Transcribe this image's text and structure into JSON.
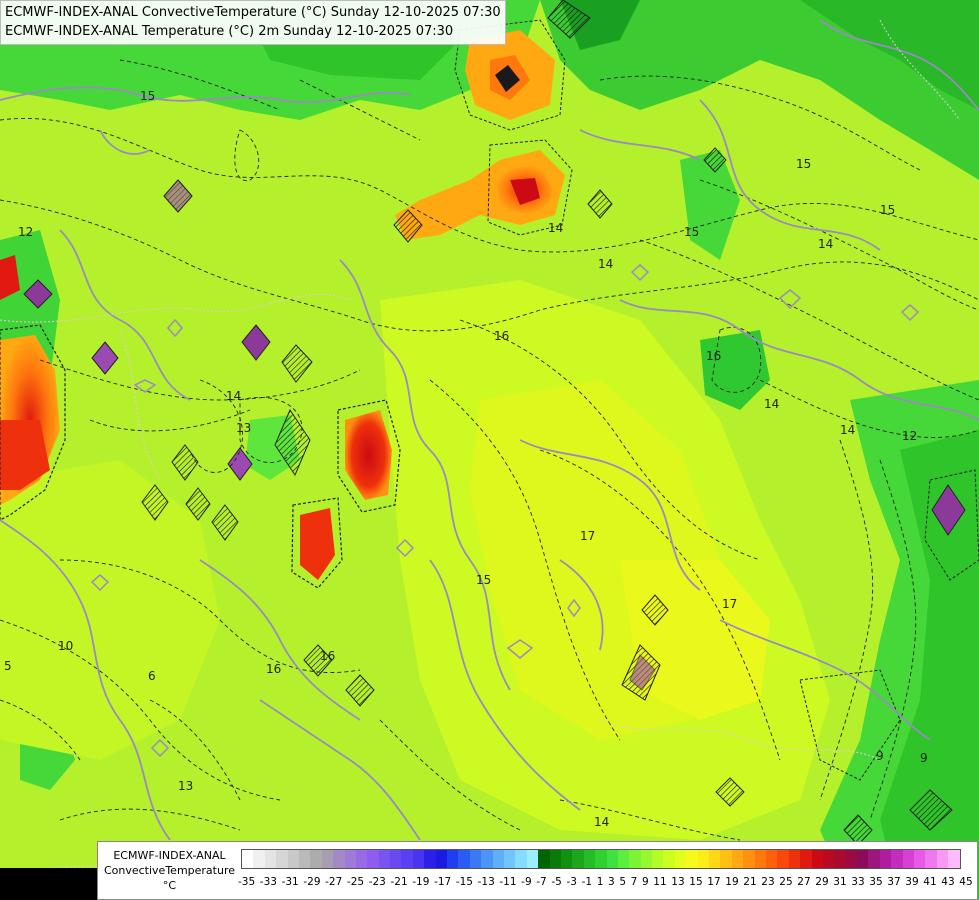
{
  "header": {
    "line1": "ECMWF-INDEX-ANAL ConvectiveTemperature (°C) Sunday 12-10-2025 07:30",
    "line2": "ECMWF-INDEX-ANAL Temperature (°C) 2m Sunday 12-10-2025 07:30"
  },
  "legend": {
    "line1": "ECMWF-INDEX-ANAL",
    "line2": "ConvectiveTemperature",
    "unit": "°C",
    "ticks": [
      "-35",
      "-33",
      "-31",
      "-29",
      "-27",
      "-25",
      "-23",
      "-21",
      "-19",
      "-17",
      "-15",
      "-13",
      "-11",
      "-9",
      "-7",
      "-5",
      "-3",
      "-1",
      "1",
      "3",
      "5",
      "7",
      "9",
      "11",
      "13",
      "15",
      "17",
      "19",
      "21",
      "23",
      "25",
      "27",
      "29",
      "31",
      "33",
      "35",
      "37",
      "39",
      "41",
      "43",
      "45"
    ],
    "colors": [
      "#ffffff",
      "#f0f0f0",
      "#e4e4e4",
      "#d6d6d6",
      "#c8c8c8",
      "#bababa",
      "#acacac",
      "#a89cb0",
      "#a48ac4",
      "#9f7ad6",
      "#9a6ae6",
      "#8f5cf2",
      "#7a54f0",
      "#6a48f2",
      "#5a40f4",
      "#4a34f0",
      "#2a20e8",
      "#1a1ae0",
      "#1e3ef0",
      "#2a5cf4",
      "#3a78f6",
      "#4c94f8",
      "#5eaefa",
      "#70c6fc",
      "#86dcfe",
      "#9ceefe",
      "#006400",
      "#0a7a0a",
      "#129012",
      "#1ca61c",
      "#26bc26",
      "#30d030",
      "#40e040",
      "#5cee3c",
      "#7af434",
      "#98f82e",
      "#b4fc28",
      "#ccfe22",
      "#e2fe1e",
      "#f4fa1c",
      "#fcec18",
      "#fed816",
      "#ffc014",
      "#ffa812",
      "#ff9010",
      "#ff780e",
      "#ff600c",
      "#f8480c",
      "#ee300c",
      "#e01a10",
      "#cc0a14",
      "#b80a20",
      "#a80a30",
      "#9a0a44",
      "#8c0a5a",
      "#9c167e",
      "#b01c9e",
      "#c42cbc",
      "#d840d4",
      "#e65ae6",
      "#ee78ee",
      "#f69af6",
      "#fcbcfc"
    ]
  },
  "map": {
    "contour_labels": [
      "12",
      "15",
      "15",
      "14",
      "14",
      "12",
      "16",
      "16",
      "14",
      "13",
      "14",
      "15",
      "17",
      "15",
      "17",
      "14",
      "13",
      "16",
      "16",
      "14",
      "15",
      "14",
      "9",
      "9",
      "6",
      "10",
      "5"
    ]
  }
}
